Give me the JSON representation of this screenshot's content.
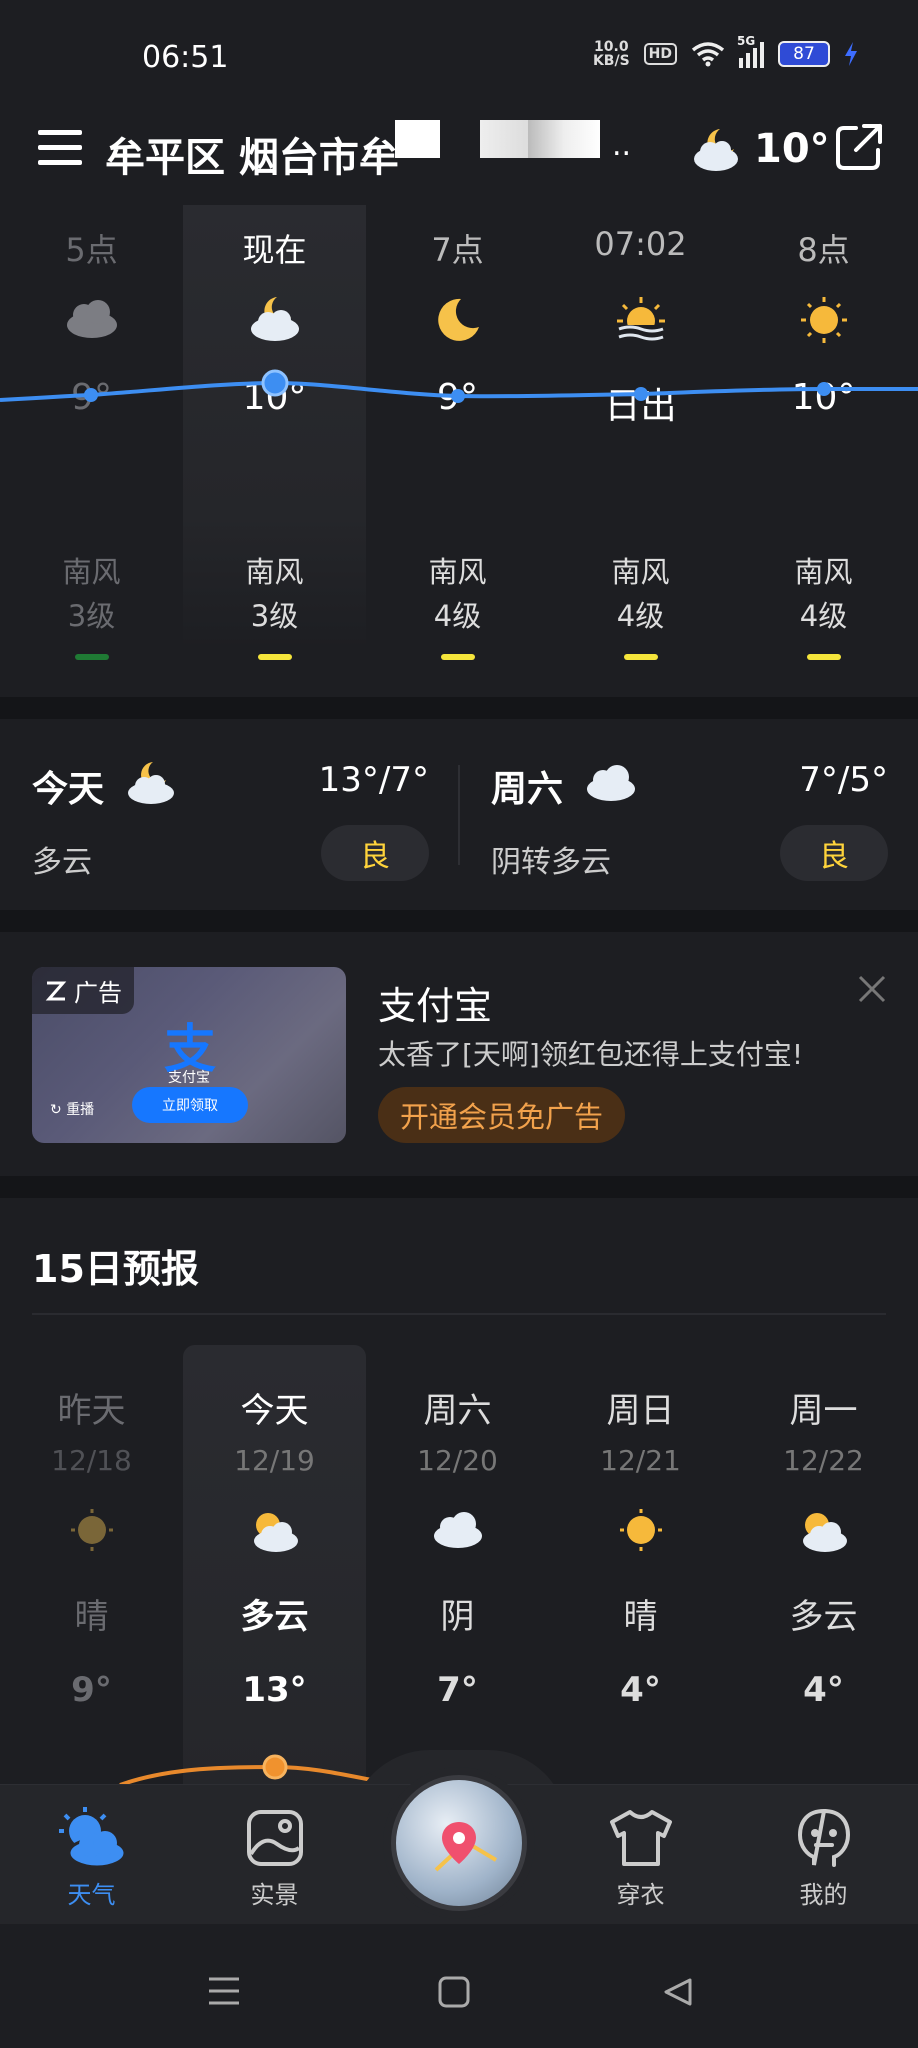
{
  "status_bar": {
    "time": "06:51",
    "net_speed_value": "10.0",
    "net_speed_unit": "KB/S",
    "hd": "HD",
    "network": "5G",
    "battery": "87"
  },
  "header": {
    "location": "牟平区 烟台市牟",
    "ellipsis": "..",
    "temp": "10°",
    "weather_icon": "partly-cloudy-night-icon"
  },
  "hourly": [
    {
      "label": "5点",
      "icon": "cloud-icon",
      "temp": "9°",
      "wind_dir": "南风",
      "wind_level": "3级",
      "wind_color": "#1f7a34",
      "dim": true
    },
    {
      "label": "现在",
      "icon": "partly-cloudy-night-icon",
      "temp": "10°",
      "wind_dir": "南风",
      "wind_level": "3级",
      "wind_color": "#f5e53b",
      "dim": false
    },
    {
      "label": "7点",
      "icon": "moon-icon",
      "temp": "9°",
      "wind_dir": "南风",
      "wind_level": "4级",
      "wind_color": "#f5e53b",
      "dim": false
    },
    {
      "label": "07:02",
      "icon": "sunrise-icon",
      "temp": "日出",
      "wind_dir": "南风",
      "wind_level": "4级",
      "wind_color": "#f5e53b",
      "dim": false
    },
    {
      "label": "8点",
      "icon": "sun-icon",
      "temp": "10°",
      "wind_dir": "南风",
      "wind_level": "4级",
      "wind_color": "#f5e53b",
      "dim": false
    }
  ],
  "today": {
    "name": "今天",
    "icon": "partly-cloudy-night-icon",
    "range": "13°/7°",
    "condition": "多云",
    "aqi": "良"
  },
  "saturday": {
    "name": "周六",
    "icon": "cloud-icon",
    "range": "7°/5°",
    "condition": "阴转多云",
    "aqi": "良"
  },
  "ad": {
    "tag": "广告",
    "logo_char": "支",
    "logo_name": "支付宝",
    "replay": "重播",
    "cta": "立即领取",
    "title": "支付宝",
    "desc": "太香了[天啊]领红包还得上支付宝!",
    "vip": "开通会员免广告"
  },
  "forecast": {
    "title": "15日预报",
    "days": [
      {
        "day": "昨天",
        "date": "12/18",
        "icon": "sun-icon",
        "cond": "晴",
        "temp": "9°",
        "dim": true
      },
      {
        "day": "今天",
        "date": "12/19",
        "icon": "partly-cloudy-day-icon",
        "cond": "多云",
        "temp": "13°",
        "dim": false
      },
      {
        "day": "周六",
        "date": "12/20",
        "icon": "cloud-icon",
        "cond": "阴",
        "temp": "7°",
        "dim": false
      },
      {
        "day": "周日",
        "date": "12/21",
        "icon": "sun-icon",
        "cond": "晴",
        "temp": "4°",
        "dim": false
      },
      {
        "day": "周一",
        "date": "12/22",
        "icon": "partly-cloudy-day-icon",
        "cond": "多云",
        "temp": "4°",
        "dim": false
      }
    ]
  },
  "nav": {
    "weather": "天气",
    "scenery": "实景",
    "clothing": "穿衣",
    "mine": "我的",
    "active_color": "#3d8ef2"
  }
}
